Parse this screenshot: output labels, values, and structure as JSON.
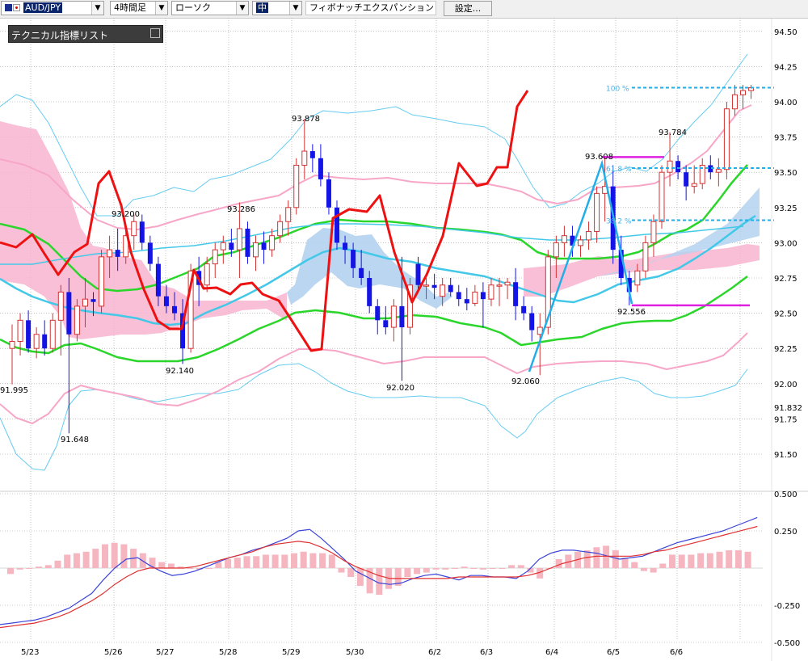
{
  "toolbar": {
    "symbol": "AUD/JPY",
    "timeframe": "4時間足",
    "chart_style": "ローソク",
    "line_width": "中",
    "drawing_tool": "フィボナッチエクスパンション",
    "settings_label": "設定..."
  },
  "indicator_panel": {
    "title": "テクニカル指標リスト"
  },
  "colors": {
    "bull_candle": "#d23232",
    "bear_candle": "#1414e6",
    "ichimoku_cloud": "#f8b4d0",
    "cloud_alt": "#b4d2f0",
    "zigzag": "#ee1111",
    "bollinger_outer": "#66ccf0",
    "bollinger_inner": "#f7a6c8",
    "ma_green": "#2ad62a",
    "ma_cyan": "#44c8e8",
    "fib_line": "#22aee8",
    "magenta": "#e020e0",
    "macd_line": "#3a44d8",
    "signal_line": "#e03030",
    "histogram": "#f6b6c0"
  },
  "chart_data": [
    {
      "type": "candlestick",
      "x_labels": [
        "5/23",
        "5/26",
        "5/27",
        "5/28",
        "5/29",
        "5/30",
        "6/2",
        "6/3",
        "6/4",
        "6/5",
        "6/6"
      ],
      "y_ticks": [
        "94.50",
        "94.25",
        "94.00",
        "93.75",
        "93.50",
        "93.25",
        "93.00",
        "92.75",
        "92.50",
        "92.25",
        "92.00",
        "91.832",
        "91.75",
        "91.50"
      ],
      "ylim": [
        91.36,
        94.52
      ],
      "grid": true,
      "annotations": [
        {
          "text": "91.995",
          "price": 91.995
        },
        {
          "text": "91.648",
          "price": 91.648
        },
        {
          "text": "93.200",
          "price": 93.2
        },
        {
          "text": "92.140",
          "price": 92.14
        },
        {
          "text": "93.286",
          "price": 93.286
        },
        {
          "text": "93.878",
          "price": 93.878
        },
        {
          "text": "92.020",
          "price": 92.02
        },
        {
          "text": "92.060",
          "price": 92.06
        },
        {
          "text": "93.608",
          "price": 93.608
        },
        {
          "text": "92.556",
          "price": 92.556
        },
        {
          "text": "93.784",
          "price": 93.784
        }
      ],
      "fib_labels": [
        "100 %",
        "61.8 %",
        "38.2 %"
      ],
      "candles": [
        {
          "o": 92.25,
          "h": 92.42,
          "l": 91.995,
          "c": 92.3
        },
        {
          "o": 92.3,
          "h": 92.5,
          "l": 92.2,
          "c": 92.45
        },
        {
          "o": 92.45,
          "h": 92.52,
          "l": 92.22,
          "c": 92.25
        },
        {
          "o": 92.25,
          "h": 92.4,
          "l": 92.18,
          "c": 92.35
        },
        {
          "o": 92.35,
          "h": 92.45,
          "l": 92.2,
          "c": 92.25
        },
        {
          "o": 92.25,
          "h": 92.5,
          "l": 92.22,
          "c": 92.45
        },
        {
          "o": 92.45,
          "h": 92.7,
          "l": 92.2,
          "c": 92.65
        },
        {
          "o": 92.65,
          "h": 92.75,
          "l": 91.648,
          "c": 92.35
        },
        {
          "o": 92.35,
          "h": 92.6,
          "l": 92.3,
          "c": 92.55
        },
        {
          "o": 92.55,
          "h": 92.75,
          "l": 92.4,
          "c": 92.6
        },
        {
          "o": 92.6,
          "h": 92.65,
          "l": 92.48,
          "c": 92.58
        },
        {
          "o": 92.55,
          "h": 92.95,
          "l": 92.5,
          "c": 92.9
        },
        {
          "o": 92.9,
          "h": 93.05,
          "l": 92.75,
          "c": 92.95
        },
        {
          "o": 92.95,
          "h": 93.1,
          "l": 92.8,
          "c": 92.9
        },
        {
          "o": 92.9,
          "h": 93.1,
          "l": 92.85,
          "c": 93.05
        },
        {
          "o": 93.05,
          "h": 93.2,
          "l": 92.95,
          "c": 93.15
        },
        {
          "o": 93.15,
          "h": 93.2,
          "l": 92.95,
          "c": 93.0
        },
        {
          "o": 93.0,
          "h": 93.05,
          "l": 92.8,
          "c": 92.85
        },
        {
          "o": 92.85,
          "h": 92.9,
          "l": 92.55,
          "c": 92.62
        },
        {
          "o": 92.62,
          "h": 92.7,
          "l": 92.5,
          "c": 92.55
        },
        {
          "o": 92.55,
          "h": 92.65,
          "l": 92.45,
          "c": 92.5
        },
        {
          "o": 92.5,
          "h": 92.6,
          "l": 92.14,
          "c": 92.25
        },
        {
          "o": 92.25,
          "h": 92.85,
          "l": 92.22,
          "c": 92.8
        },
        {
          "o": 92.8,
          "h": 92.9,
          "l": 92.55,
          "c": 92.7
        },
        {
          "o": 92.7,
          "h": 92.9,
          "l": 92.65,
          "c": 92.85
        },
        {
          "o": 92.85,
          "h": 93.0,
          "l": 92.75,
          "c": 92.95
        },
        {
          "o": 92.95,
          "h": 93.05,
          "l": 92.85,
          "c": 93.0
        },
        {
          "o": 93.0,
          "h": 93.1,
          "l": 92.9,
          "c": 92.95
        },
        {
          "o": 92.95,
          "h": 93.286,
          "l": 92.75,
          "c": 93.1
        },
        {
          "o": 93.1,
          "h": 93.15,
          "l": 92.85,
          "c": 92.9
        },
        {
          "o": 92.9,
          "h": 93.05,
          "l": 92.8,
          "c": 93.0
        },
        {
          "o": 93.0,
          "h": 93.08,
          "l": 92.85,
          "c": 92.95
        },
        {
          "o": 92.95,
          "h": 93.1,
          "l": 92.9,
          "c": 93.05
        },
        {
          "o": 93.05,
          "h": 93.2,
          "l": 93.0,
          "c": 93.15
        },
        {
          "o": 93.15,
          "h": 93.3,
          "l": 93.05,
          "c": 93.25
        },
        {
          "o": 93.25,
          "h": 93.6,
          "l": 93.2,
          "c": 93.55
        },
        {
          "o": 93.55,
          "h": 93.878,
          "l": 93.45,
          "c": 93.65
        },
        {
          "o": 93.65,
          "h": 93.7,
          "l": 93.5,
          "c": 93.6
        },
        {
          "o": 93.6,
          "h": 93.7,
          "l": 93.4,
          "c": 93.45
        },
        {
          "o": 93.45,
          "h": 93.5,
          "l": 93.2,
          "c": 93.25
        },
        {
          "o": 93.25,
          "h": 93.3,
          "l": 92.95,
          "c": 93.0
        },
        {
          "o": 93.0,
          "h": 93.05,
          "l": 92.85,
          "c": 92.95
        },
        {
          "o": 92.95,
          "h": 93.0,
          "l": 92.75,
          "c": 92.82
        },
        {
          "o": 92.82,
          "h": 92.95,
          "l": 92.7,
          "c": 92.75
        },
        {
          "o": 92.75,
          "h": 92.8,
          "l": 92.5,
          "c": 92.55
        },
        {
          "o": 92.55,
          "h": 92.6,
          "l": 92.35,
          "c": 92.45
        },
        {
          "o": 92.45,
          "h": 92.55,
          "l": 92.35,
          "c": 92.4
        },
        {
          "o": 92.4,
          "h": 92.6,
          "l": 92.3,
          "c": 92.55
        },
        {
          "o": 92.55,
          "h": 92.9,
          "l": 92.02,
          "c": 92.4
        },
        {
          "o": 92.4,
          "h": 92.75,
          "l": 92.35,
          "c": 92.7
        },
        {
          "o": 92.85,
          "h": 92.9,
          "l": 92.65,
          "c": 92.7
        },
        {
          "o": 92.7,
          "h": 92.75,
          "l": 92.6,
          "c": 92.7
        },
        {
          "o": 92.7,
          "h": 92.78,
          "l": 92.6,
          "c": 92.68
        },
        {
          "o": 92.62,
          "h": 92.75,
          "l": 92.55,
          "c": 92.7
        },
        {
          "o": 92.7,
          "h": 92.75,
          "l": 92.62,
          "c": 92.65
        },
        {
          "o": 92.65,
          "h": 92.7,
          "l": 92.55,
          "c": 92.6
        },
        {
          "o": 92.6,
          "h": 92.68,
          "l": 92.52,
          "c": 92.57
        },
        {
          "o": 92.57,
          "h": 92.7,
          "l": 92.55,
          "c": 92.65
        },
        {
          "o": 92.65,
          "h": 92.72,
          "l": 92.4,
          "c": 92.6
        },
        {
          "o": 92.6,
          "h": 92.75,
          "l": 92.55,
          "c": 92.7
        },
        {
          "o": 92.7,
          "h": 92.75,
          "l": 92.55,
          "c": 92.7
        },
        {
          "o": 92.7,
          "h": 92.75,
          "l": 92.6,
          "c": 92.72
        },
        {
          "o": 92.72,
          "h": 92.82,
          "l": 92.45,
          "c": 92.55
        },
        {
          "o": 92.55,
          "h": 92.62,
          "l": 92.45,
          "c": 92.5
        },
        {
          "o": 92.5,
          "h": 92.55,
          "l": 92.3,
          "c": 92.38
        },
        {
          "o": 92.35,
          "h": 92.5,
          "l": 92.06,
          "c": 92.4
        },
        {
          "o": 92.4,
          "h": 92.95,
          "l": 92.35,
          "c": 92.9
        },
        {
          "o": 92.9,
          "h": 93.05,
          "l": 92.75,
          "c": 93.0
        },
        {
          "o": 93.0,
          "h": 93.12,
          "l": 92.9,
          "c": 93.05
        },
        {
          "o": 93.05,
          "h": 93.12,
          "l": 92.9,
          "c": 92.98
        },
        {
          "o": 92.98,
          "h": 93.05,
          "l": 92.9,
          "c": 93.02
        },
        {
          "o": 93.02,
          "h": 93.15,
          "l": 92.95,
          "c": 93.08
        },
        {
          "o": 93.08,
          "h": 93.4,
          "l": 93.0,
          "c": 93.35
        },
        {
          "o": 93.35,
          "h": 93.608,
          "l": 93.15,
          "c": 93.4
        },
        {
          "o": 93.4,
          "h": 93.55,
          "l": 92.85,
          "c": 92.95
        },
        {
          "o": 92.95,
          "h": 93.05,
          "l": 92.7,
          "c": 92.75
        },
        {
          "o": 92.75,
          "h": 92.8,
          "l": 92.556,
          "c": 92.65
        },
        {
          "o": 92.7,
          "h": 92.85,
          "l": 92.65,
          "c": 92.8
        },
        {
          "o": 92.8,
          "h": 93.05,
          "l": 92.75,
          "c": 93.0
        },
        {
          "o": 93.0,
          "h": 93.2,
          "l": 92.9,
          "c": 93.15
        },
        {
          "o": 93.15,
          "h": 93.55,
          "l": 93.1,
          "c": 93.5
        },
        {
          "o": 93.5,
          "h": 93.784,
          "l": 93.4,
          "c": 93.58
        },
        {
          "o": 93.58,
          "h": 93.62,
          "l": 93.45,
          "c": 93.5
        },
        {
          "o": 93.5,
          "h": 93.55,
          "l": 93.3,
          "c": 93.4
        },
        {
          "o": 93.4,
          "h": 93.55,
          "l": 93.35,
          "c": 93.42
        },
        {
          "o": 93.42,
          "h": 93.6,
          "l": 93.38,
          "c": 93.55
        },
        {
          "o": 93.55,
          "h": 93.62,
          "l": 93.45,
          "c": 93.5
        },
        {
          "o": 93.5,
          "h": 93.6,
          "l": 93.4,
          "c": 93.52
        },
        {
          "o": 93.52,
          "h": 94.0,
          "l": 93.45,
          "c": 93.95
        },
        {
          "o": 93.95,
          "h": 94.12,
          "l": 93.9,
          "c": 94.05
        },
        {
          "o": 94.05,
          "h": 94.12,
          "l": 93.95,
          "c": 94.08
        },
        {
          "o": 94.08,
          "h": 94.12,
          "l": 94.02,
          "c": 94.1
        }
      ],
      "fib_levels": [
        {
          "label": "100 %",
          "price": 94.1
        },
        {
          "label": "61.8 %",
          "price": 93.53
        },
        {
          "label": "38.2 %",
          "price": 93.16
        }
      ]
    },
    {
      "type": "line",
      "name": "MACD",
      "y_ticks": [
        "0.500",
        "0.250",
        "-0.250",
        "-0.500"
      ],
      "ylim": [
        -0.55,
        0.55
      ],
      "histogram": [
        -0.04,
        -0.01,
        0.0,
        0.01,
        0.02,
        0.05,
        0.09,
        0.1,
        0.11,
        0.13,
        0.16,
        0.17,
        0.16,
        0.13,
        0.1,
        0.07,
        0.04,
        0.03,
        0.01,
        0.0,
        -0.01,
        0.0,
        0.04,
        0.06,
        0.07,
        0.08,
        0.08,
        0.09,
        0.09,
        0.09,
        0.1,
        0.11,
        0.1,
        0.1,
        0.09,
        -0.03,
        -0.06,
        -0.12,
        -0.17,
        -0.18,
        -0.14,
        -0.12,
        -0.06,
        -0.04,
        -0.03,
        -0.01,
        -0.01,
        0.0,
        0.01,
        0.0,
        -0.01,
        0.0,
        0.0,
        0.02,
        0.02,
        -0.03,
        -0.07,
        0.0,
        0.06,
        0.09,
        0.11,
        0.12,
        0.14,
        0.15,
        0.12,
        0.07,
        0.04,
        -0.02,
        -0.03,
        0.03,
        0.09,
        0.09,
        0.09,
        0.1,
        0.1,
        0.11,
        0.12,
        0.12,
        0.11
      ],
      "series": [
        {
          "name": "MACD",
          "values": [
            -0.38,
            -0.37,
            -0.36,
            -0.35,
            -0.33,
            -0.3,
            -0.27,
            -0.22,
            -0.17,
            -0.08,
            0.0,
            0.06,
            0.07,
            0.02,
            -0.02,
            -0.05,
            -0.04,
            -0.02,
            0.01,
            0.04,
            0.07,
            0.09,
            0.12,
            0.14,
            0.17,
            0.2,
            0.25,
            0.26,
            0.2,
            0.13,
            0.06,
            -0.02,
            -0.06,
            -0.1,
            -0.11,
            -0.1,
            -0.07,
            -0.05,
            -0.04,
            -0.06,
            -0.08,
            -0.05,
            -0.05,
            -0.06,
            -0.06,
            -0.07,
            -0.02,
            0.06,
            0.1,
            0.12,
            0.12,
            0.11,
            0.1,
            0.08,
            0.06,
            0.07,
            0.08,
            0.11,
            0.14,
            0.17,
            0.19,
            0.21,
            0.23,
            0.25,
            0.28,
            0.31,
            0.34
          ]
        },
        {
          "name": "Signal",
          "values": [
            -0.4,
            -0.39,
            -0.38,
            -0.37,
            -0.35,
            -0.33,
            -0.3,
            -0.26,
            -0.22,
            -0.17,
            -0.11,
            -0.06,
            -0.02,
            0.0,
            0.0,
            0.0,
            0.0,
            0.01,
            0.03,
            0.05,
            0.07,
            0.09,
            0.11,
            0.14,
            0.16,
            0.17,
            0.18,
            0.17,
            0.14,
            0.1,
            0.05,
            0.01,
            -0.02,
            -0.05,
            -0.07,
            -0.07,
            -0.07,
            -0.07,
            -0.07,
            -0.07,
            -0.06,
            -0.06,
            -0.06,
            -0.06,
            -0.06,
            -0.06,
            -0.05,
            -0.03,
            0.0,
            0.03,
            0.05,
            0.07,
            0.08,
            0.08,
            0.08,
            0.08,
            0.09,
            0.11,
            0.12,
            0.14,
            0.16,
            0.18,
            0.2,
            0.22,
            0.24,
            0.26,
            0.28
          ]
        }
      ]
    }
  ]
}
